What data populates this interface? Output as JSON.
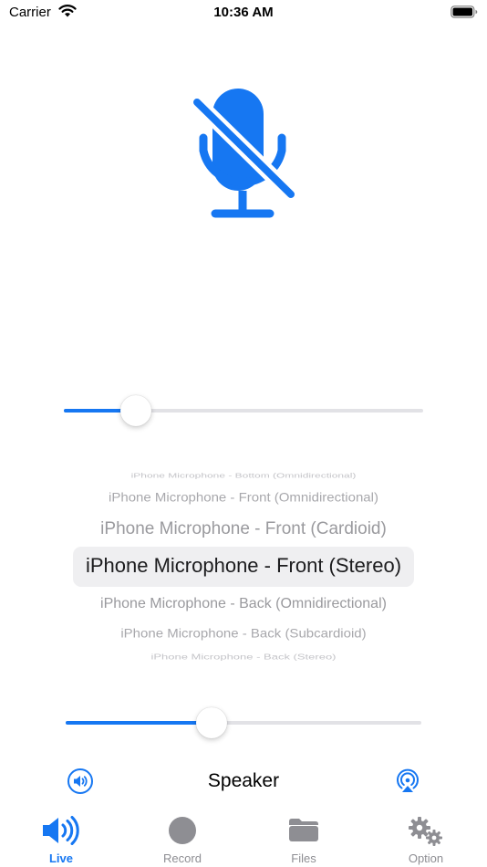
{
  "status_bar": {
    "carrier": "Carrier",
    "time": "10:36 AM"
  },
  "mic_icon": "mic-slash-icon",
  "gain_slider": {
    "value": 0.2
  },
  "input_picker": {
    "options": [
      "iPhone Microphone - Bottom (Omnidirectional)",
      "iPhone Microphone - Front (Omnidirectional)",
      "iPhone Microphone - Front (Cardioid)",
      "iPhone Microphone - Front (Stereo)",
      "iPhone Microphone - Back (Omnidirectional)",
      "iPhone Microphone - Back (Subcardioid)",
      "iPhone Microphone - Back (Stereo)"
    ],
    "selected_index": 3
  },
  "volume_slider": {
    "value": 0.41
  },
  "output_route": {
    "label": "Speaker",
    "left_icon": "speaker-circle-icon",
    "right_icon": "airplay-icon"
  },
  "tabs": [
    {
      "label": "Live",
      "icon": "speaker-wave-icon",
      "active": true
    },
    {
      "label": "Record",
      "icon": "record-circle-icon",
      "active": false
    },
    {
      "label": "Files",
      "icon": "folder-icon",
      "active": false
    },
    {
      "label": "Option",
      "icon": "gears-icon",
      "active": false
    }
  ],
  "colors": {
    "accent": "#1677f2",
    "inactive": "#8e8e93"
  }
}
